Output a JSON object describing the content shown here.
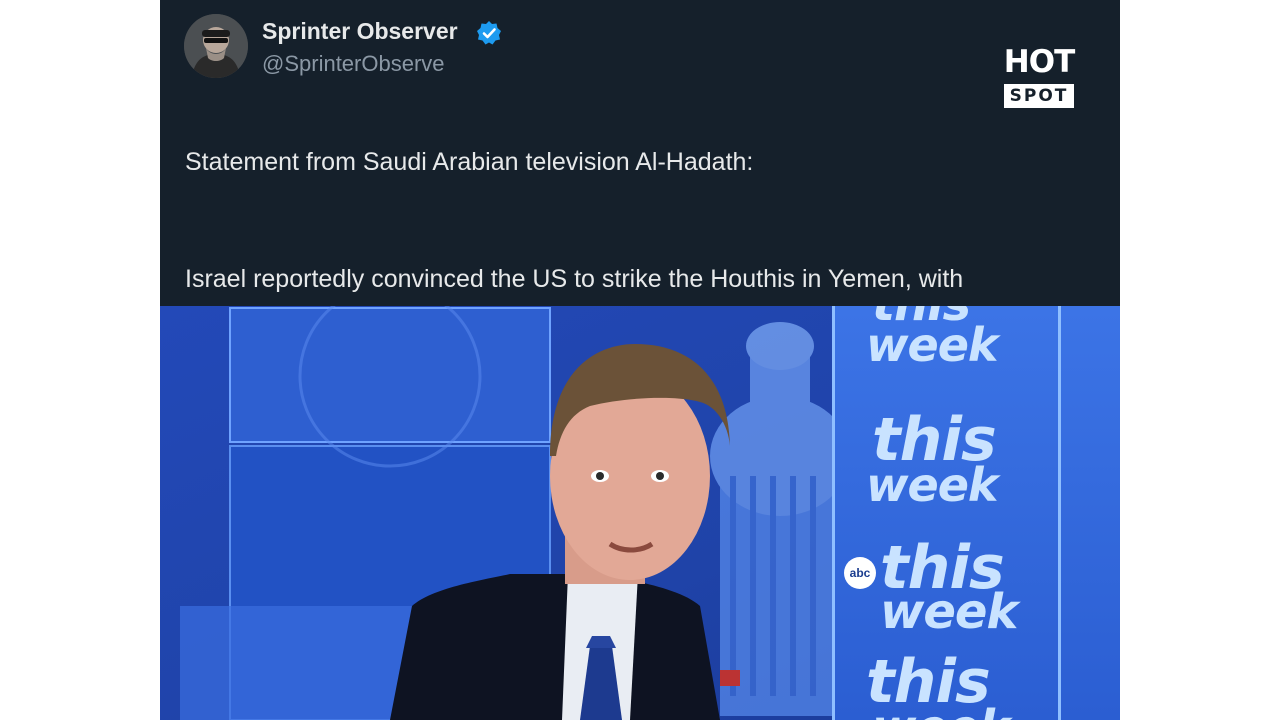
{
  "tweet": {
    "author_name": "Sprinter Observer",
    "author_handle": "@SprinterObserve",
    "verified_icon": "verified-badge-icon",
    "text_line_1": "Statement from Saudi Arabian television Al-Hadath:",
    "text_line_2": "Israel reportedly convinced the US to strike the Houthis in Yemen, with\nthe two countries agreeing that Yemen would be the \"first step\" in\nattacking Iran."
  },
  "logo": {
    "top": "HOT",
    "bottom": "SPOT"
  },
  "video": {
    "show_wordmarks": [
      "this",
      "week",
      "this",
      "week",
      "this",
      "week",
      "this",
      "week"
    ],
    "network_logo": "abc",
    "colors": {
      "background": "#1b3fa8",
      "panel": "#2a5bd6",
      "wordmark": "#c9e3ff"
    }
  }
}
